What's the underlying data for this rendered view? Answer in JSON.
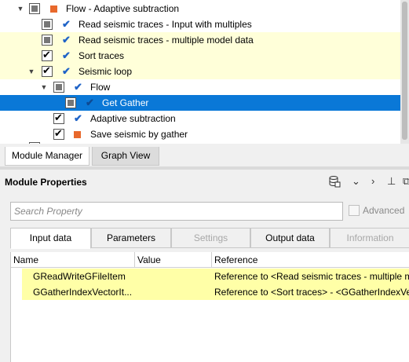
{
  "tree": {
    "items": [
      {
        "label": "Flow - Adaptive subtraction"
      },
      {
        "label": "Read seismic traces - Input with multiples"
      },
      {
        "label": "Read seismic traces - multiple model data"
      },
      {
        "label": "Sort traces"
      },
      {
        "label": "Seismic loop"
      },
      {
        "label": "Flow"
      },
      {
        "label": "Get Gather"
      },
      {
        "label": "Adaptive subtraction"
      },
      {
        "label": "Save seismic by gather"
      }
    ]
  },
  "bottom_tabs": {
    "module_manager": "Module Manager",
    "graph_view": "Graph View"
  },
  "module_properties": {
    "title": "Module Properties",
    "search_placeholder": "Search Property",
    "advanced_label": "Advanced",
    "tabs": [
      "Input data",
      "Parameters",
      "Settings",
      "Output data",
      "Information"
    ],
    "grid": {
      "columns": [
        "Name",
        "Value",
        "Reference"
      ],
      "rows": [
        {
          "name": "GReadWriteGFileItem",
          "value": "",
          "reference": "Reference to <Read seismic traces - multiple model data>"
        },
        {
          "name": "GGatherIndexVectorIt...",
          "value": "",
          "reference": "Reference to <Sort traces> - <GGatherIndexVectorItem>"
        }
      ]
    }
  },
  "colors": {
    "selection": "#0a78d7",
    "highlight": "#ffffd9",
    "grid_highlight": "#ffffa7",
    "orange": "#e8692c",
    "checkmark_blue": "#1f63c7"
  }
}
